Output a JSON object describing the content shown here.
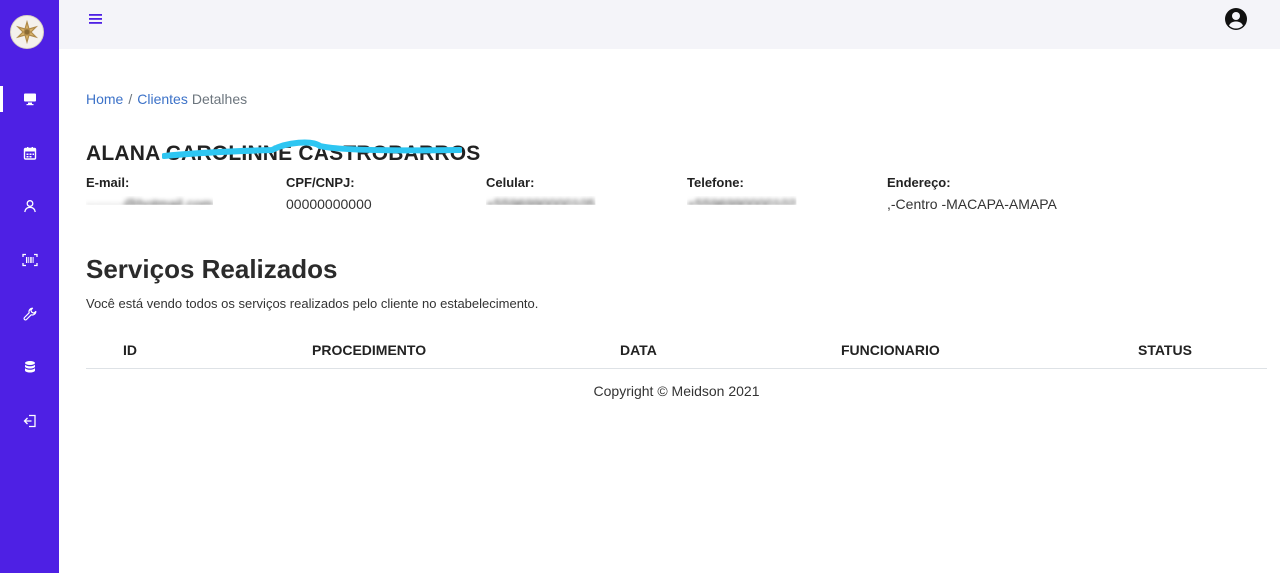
{
  "sidebar": {
    "items": [
      {
        "name": "monitor-icon",
        "active": true
      },
      {
        "name": "calendar-icon",
        "active": false
      },
      {
        "name": "user-icon",
        "active": false
      },
      {
        "name": "scan-icon",
        "active": false
      },
      {
        "name": "wrench-icon",
        "active": false
      },
      {
        "name": "database-icon",
        "active": false
      },
      {
        "name": "logout-icon",
        "active": false
      }
    ]
  },
  "colors": {
    "sidebar_bg": "#4e20e4",
    "topbar_bg": "#f4f4f9",
    "link": "#3c72c8",
    "redaction": "#2ec6f2"
  },
  "breadcrumb": {
    "home": "Home",
    "separator": "/",
    "clients": "Clientes",
    "current": "Detalhes"
  },
  "client": {
    "name": "ALANA CAROLINNE CASTROBARROS",
    "fields": {
      "email_label": "E-mail:",
      "email_value": "········@hotmail.com",
      "cpf_label": "CPF/CNPJ:",
      "cpf_value": "00000000000",
      "celular_label": "Celular:",
      "celular_value": "+5596990000105",
      "telefone_label": "Telefone:",
      "telefone_value": "+5596990000102",
      "endereco_label": "Endereço:",
      "endereco_value": ",-Centro -MACAPA-AMAPA"
    }
  },
  "services": {
    "title": "Serviços Realizados",
    "description": "Você está vendo todos os serviços realizados pelo cliente no estabelecimento.",
    "columns": [
      "ID",
      "PROCEDIMENTO",
      "DATA",
      "FUNCIONARIO",
      "STATUS"
    ]
  },
  "footer": {
    "copyright": "Copyright © Meidson 2021"
  }
}
